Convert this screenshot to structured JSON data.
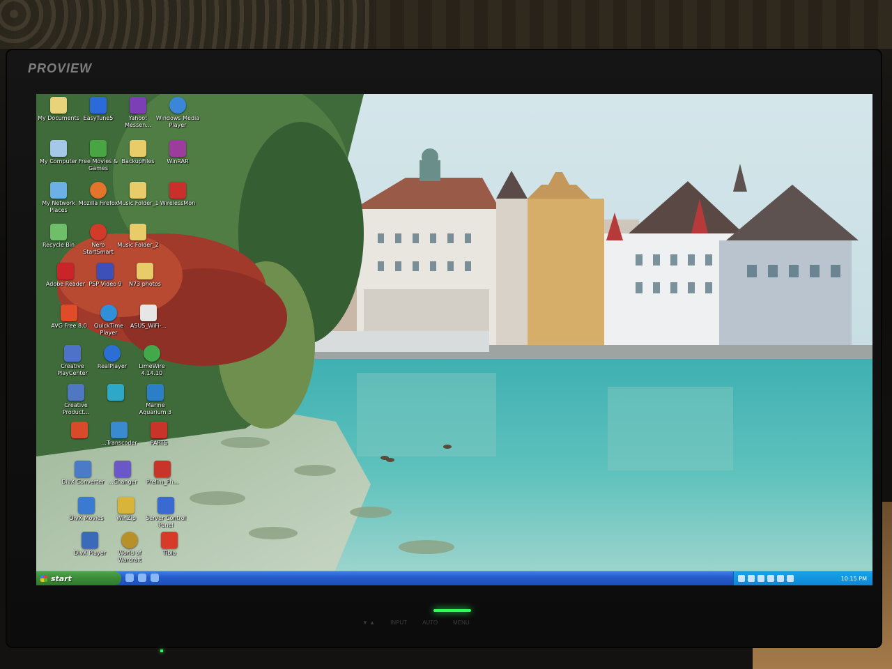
{
  "monitor": {
    "brand": "PROVIEW",
    "buttons": [
      "▼ ▲",
      "INPUT",
      "AUTO",
      "MENU"
    ]
  },
  "desktop": {
    "icons": [
      {
        "label": "My Documents",
        "color": "#e8d27a"
      },
      {
        "label": "EasyTune5",
        "color": "#2a6ad9"
      },
      {
        "label": "Yahoo! Messen...",
        "color": "#7c3fb5"
      },
      {
        "label": "Windows Media Player",
        "color": "#3a86d8"
      },
      {
        "label": "My Computer",
        "color": "#a6c8e8"
      },
      {
        "label": "Free Movies & Games",
        "color": "#48a542"
      },
      {
        "label": "BackupFiles",
        "color": "#e8cc6a"
      },
      {
        "label": "WinRAR",
        "color": "#9b3c9e"
      },
      {
        "label": "My Network Places",
        "color": "#6cb0e6"
      },
      {
        "label": "Mozilla Firefox",
        "color": "#e2742c"
      },
      {
        "label": "Music Folder_1",
        "color": "#e8cc6a"
      },
      {
        "label": "WirelessMon",
        "color": "#c9302c"
      },
      {
        "label": "Recycle Bin",
        "color": "#6fbf6a"
      },
      {
        "label": "Nero StartSmart",
        "color": "#d23a2a"
      },
      {
        "label": "Music Folder_2",
        "color": "#e8cc6a"
      },
      {
        "label": "Adobe Reader",
        "color": "#c8242a"
      },
      {
        "label": "PSP Video 9",
        "color": "#3d4fb8"
      },
      {
        "label": "N73 photos",
        "color": "#e8cc6a"
      },
      {
        "label": "AVG Free 8.0",
        "color": "#e04c2a"
      },
      {
        "label": "QuickTime Player",
        "color": "#2f8fd8"
      },
      {
        "label": "ASUS_WiFi-...",
        "color": "#e6e6e6"
      },
      {
        "label": "Creative PlayCenter",
        "color": "#4d72c8"
      },
      {
        "label": "RealPlayer",
        "color": "#2b6fd6"
      },
      {
        "label": "LimeWire 4.14.10",
        "color": "#42a84a"
      },
      {
        "label": "Creative Product...",
        "color": "#5078c2"
      },
      {
        "label": "",
        "color": "#2ea8c8"
      },
      {
        "label": "Marine Aquarium 3",
        "color": "#2b7fc8"
      },
      {
        "label": "",
        "color": "#d84a2a"
      },
      {
        "label": "...Transcoder",
        "color": "#3a8ad0"
      },
      {
        "label": "PARTS",
        "color": "#c8342a"
      },
      {
        "label": "DivX Converter",
        "color": "#4a7ac8"
      },
      {
        "label": "...Changer",
        "color": "#6a58c8"
      },
      {
        "label": "Prelim_Ph...",
        "color": "#c8342a"
      },
      {
        "label": "DivX Movies",
        "color": "#3a7ad0"
      },
      {
        "label": "WinZip",
        "color": "#d8b43a"
      },
      {
        "label": "Server Control Panel",
        "color": "#3a6ad0"
      },
      {
        "label": "DivX Player",
        "color": "#3a6ab8"
      },
      {
        "label": "World of Warcraft",
        "color": "#b8902a"
      },
      {
        "label": "Tibia",
        "color": "#d83a2a"
      }
    ]
  },
  "taskbar": {
    "start_label": "start",
    "clock": "10:15 PM"
  }
}
